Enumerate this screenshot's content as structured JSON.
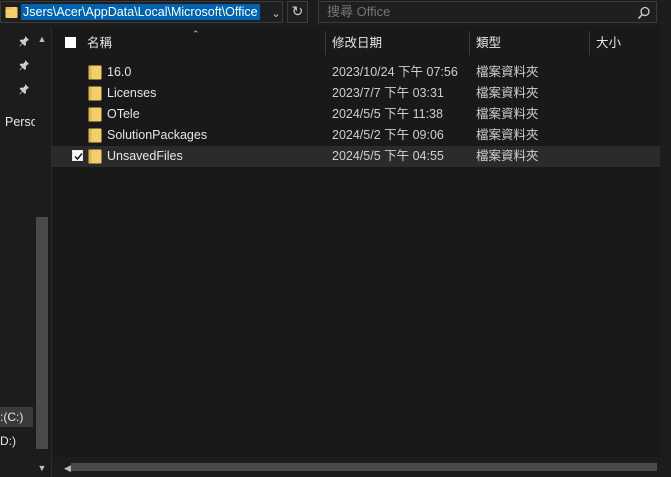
{
  "address_bar": {
    "path": "Jsers\\Acer\\AppData\\Local\\Microsoft\\Office",
    "dropdown_icon": "chevron-down-icon",
    "refresh_icon": "refresh-icon"
  },
  "search": {
    "placeholder": "搜尋 Office",
    "icon": "search-icon"
  },
  "nav": {
    "pinned_items": [
      "pin-icon",
      "pin-icon",
      "pin-icon"
    ],
    "perso_label": "Perso",
    "drive_c_label": ":(C:)",
    "drive_d_label": "D:)"
  },
  "columns": {
    "name": "名稱",
    "date_modified": "修改日期",
    "type": "類型",
    "size": "大小"
  },
  "rows": [
    {
      "name": "16.0",
      "date": "2023/10/24 下午 07:56",
      "type": "檔案資料夾",
      "checked": false,
      "selected": false
    },
    {
      "name": "Licenses",
      "date": "2023/7/7 下午 03:31",
      "type": "檔案資料夾",
      "checked": false,
      "selected": false
    },
    {
      "name": "OTele",
      "date": "2024/5/5 下午 11:38",
      "type": "檔案資料夾",
      "checked": false,
      "selected": false
    },
    {
      "name": "SolutionPackages",
      "date": "2024/5/2 下午 09:06",
      "type": "檔案資料夾",
      "checked": false,
      "selected": false
    },
    {
      "name": "UnsavedFiles",
      "date": "2024/5/5 下午 04:55",
      "type": "檔案資料夾",
      "checked": true,
      "selected": true
    }
  ],
  "colors": {
    "background": "#191919",
    "selection": "#2b2b2b",
    "address_highlight": "#0063b1",
    "folder": "#f3cf6a"
  }
}
